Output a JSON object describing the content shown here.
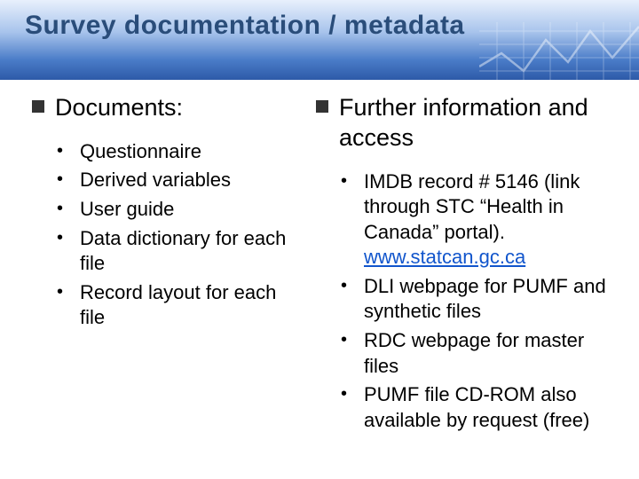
{
  "title": "Survey documentation / metadata",
  "left": {
    "heading": "Documents:",
    "items": [
      "Questionnaire",
      "Derived variables",
      "User guide",
      "Data dictionary for each file",
      "Record layout for each file"
    ]
  },
  "right": {
    "heading": "Further information and access",
    "items": [
      {
        "pre": "IMDB record # 5146 (link through STC “Health in Canada” portal). ",
        "link": "www.statcan.gc.ca",
        "post": ""
      },
      {
        "pre": "DLI webpage for PUMF and synthetic files",
        "link": "",
        "post": ""
      },
      {
        "pre": "RDC webpage for master files",
        "link": "",
        "post": ""
      },
      {
        "pre": "PUMF file CD-ROM also available by request (free)",
        "link": "",
        "post": ""
      }
    ]
  }
}
